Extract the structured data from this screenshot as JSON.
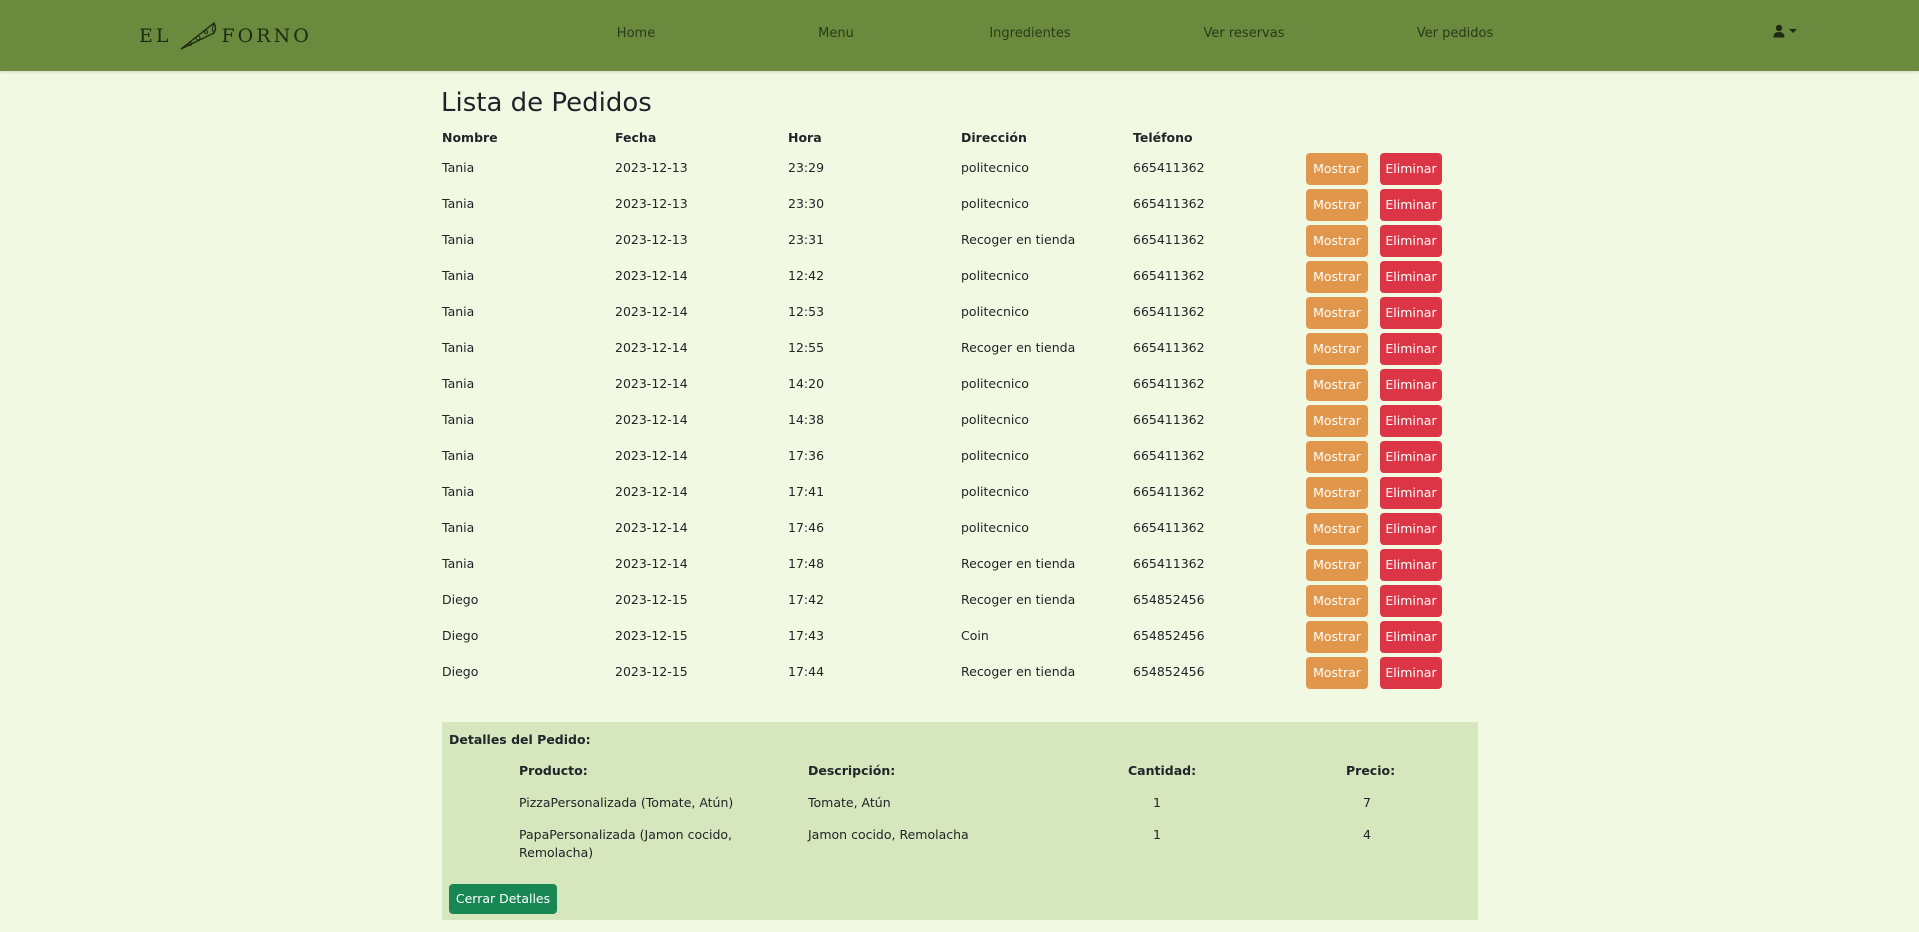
{
  "nav": {
    "logo_left": "EL",
    "logo_right": "FORNO",
    "links": [
      "Home",
      "Menu",
      "Ingredientes",
      "Ver reservas",
      "Ver pedidos"
    ],
    "user_icon": "user-icon",
    "dropdown_icon": "caret-down-icon"
  },
  "page": {
    "title": "Lista de Pedidos"
  },
  "orders": {
    "columns": [
      "Nombre",
      "Fecha",
      "Hora",
      "Dirección",
      "Teléfono"
    ],
    "show_label": "Mostrar",
    "delete_label": "Eliminar",
    "rows": [
      [
        "Tania",
        "2023-12-13",
        "23:29",
        "politecnico",
        "665411362"
      ],
      [
        "Tania",
        "2023-12-13",
        "23:30",
        "politecnico",
        "665411362"
      ],
      [
        "Tania",
        "2023-12-13",
        "23:31",
        "Recoger en tienda",
        "665411362"
      ],
      [
        "Tania",
        "2023-12-14",
        "12:42",
        "politecnico",
        "665411362"
      ],
      [
        "Tania",
        "2023-12-14",
        "12:53",
        "politecnico",
        "665411362"
      ],
      [
        "Tania",
        "2023-12-14",
        "12:55",
        "Recoger en tienda",
        "665411362"
      ],
      [
        "Tania",
        "2023-12-14",
        "14:20",
        "politecnico",
        "665411362"
      ],
      [
        "Tania",
        "2023-12-14",
        "14:38",
        "politecnico",
        "665411362"
      ],
      [
        "Tania",
        "2023-12-14",
        "17:36",
        "politecnico",
        "665411362"
      ],
      [
        "Tania",
        "2023-12-14",
        "17:41",
        "politecnico",
        "665411362"
      ],
      [
        "Tania",
        "2023-12-14",
        "17:46",
        "politecnico",
        "665411362"
      ],
      [
        "Tania",
        "2023-12-14",
        "17:48",
        "Recoger en tienda",
        "665411362"
      ],
      [
        "Diego",
        "2023-12-15",
        "17:42",
        "Recoger en tienda",
        "654852456"
      ],
      [
        "Diego",
        "2023-12-15",
        "17:43",
        "Coin",
        "654852456"
      ],
      [
        "Diego",
        "2023-12-15",
        "17:44",
        "Recoger en tienda",
        "654852456"
      ]
    ]
  },
  "details": {
    "title": "Detalles del Pedido:",
    "columns": [
      "Producto:",
      "Descripción:",
      "Cantidad:",
      "Precio:"
    ],
    "items": [
      {
        "producto": "PizzaPersonalizada (Tomate, Atún)",
        "descripcion": "Tomate, Atún",
        "cantidad": "1",
        "precio": "7"
      },
      {
        "producto": "PapaPersonalizada (Jamon cocido, Remolacha)",
        "descripcion": "Jamon cocido, Remolacha",
        "cantidad": "1",
        "precio": "4"
      }
    ],
    "close_label": "Cerrar Detalles"
  },
  "colors": {
    "navbar": "#6a8a3e",
    "background": "#f1f9e2",
    "show_button": "#e0974b",
    "delete_button": "#dc3545",
    "details_panel": "#d6e6bd",
    "close_button": "#198754"
  }
}
